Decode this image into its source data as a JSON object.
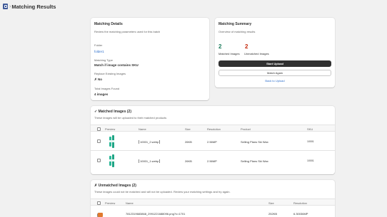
{
  "header": {
    "title": "Matching Results",
    "app_icon": "app-icon"
  },
  "details": {
    "heading": "Matching Details",
    "subtitle": "Review the matching parameters used for this batch",
    "folder_label": "Folder",
    "folder_value": "folder1",
    "matching_type_label": "Matching Type",
    "matching_type_value": "Match if image contains SKU",
    "replace_label": "Replace Existing Images",
    "replace_value": "✗ No",
    "total_label": "Total Images Found",
    "total_value": "4 images"
  },
  "summary": {
    "heading": "Matching Summary",
    "subtitle": "Overview of matching results",
    "matched_count": "2",
    "unmatched_count": "2",
    "matched_label": "Matched Images",
    "unmatched_label": "Unmatched Images",
    "start_upload_label": "Start Upload",
    "match_again_label": "Match Again",
    "back_label": "Back to Upload"
  },
  "matched": {
    "heading": "✓ Matched Images (2)",
    "subtitle": "These images will be uploaded to their matched products",
    "columns": [
      "Preview",
      "Name",
      "Size",
      "Resolution",
      "Product",
      "SKU"
    ],
    "rows": [
      {
        "name": "10001_2.webp",
        "size": "26KB",
        "resolution": "2.56MP",
        "product": "Selling Plans Ski Wax",
        "sku": "10001"
      },
      {
        "name": "10001_1.webp",
        "size": "26KB",
        "resolution": "2.56MP",
        "product": "Selling Plans Ski Wax",
        "sku": "10001"
      }
    ]
  },
  "unmatched": {
    "heading": "✗ Unmatched Images (2)",
    "subtitle": "These images could not be matched and will not be uploaded. Review your matching settings and try again.",
    "columns": [
      "Preview",
      "Name",
      "Size",
      "Resolution"
    ],
    "rows": [
      {
        "name": "7812319683868_2991221688096.png?v=1701",
        "size": "252KB",
        "resolution": "6.30036MP"
      }
    ]
  },
  "colors": {
    "accent": "#2c6ecb",
    "matched": "#1a7a5a",
    "unmatched": "#c5280c",
    "primary_button": "#303030"
  }
}
